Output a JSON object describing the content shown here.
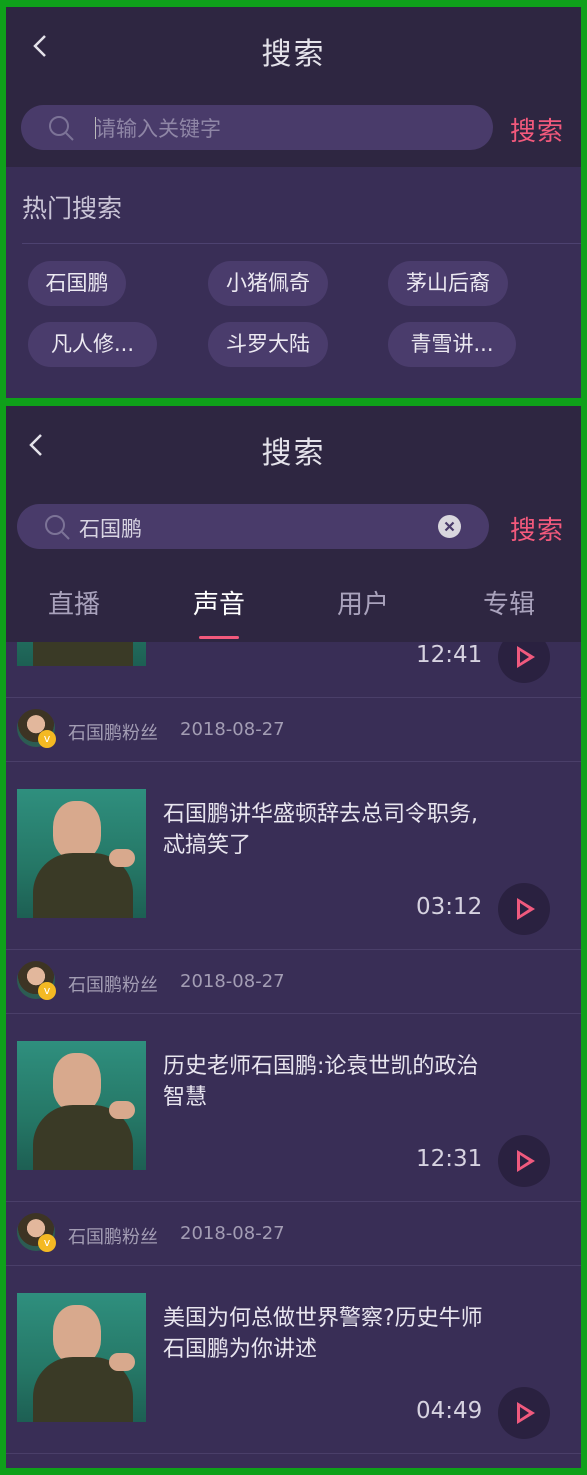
{
  "screen1": {
    "header_title": "搜索",
    "search_placeholder": "请输入关键字",
    "search_button": "搜索",
    "hot_search_title": "热门搜索",
    "hot_tags": [
      "石国鹏",
      "小猪佩奇",
      "茅山后裔",
      "凡人修...",
      "斗罗大陆",
      "青雪讲..."
    ]
  },
  "screen2": {
    "header_title": "搜索",
    "search_value": "石国鹏",
    "search_button": "搜索",
    "tabs": [
      {
        "label": "直播",
        "active": false
      },
      {
        "label": "声音",
        "active": true
      },
      {
        "label": "用户",
        "active": false
      },
      {
        "label": "专辑",
        "active": false
      }
    ],
    "partial_item": {
      "duration": "12:41"
    },
    "items": [
      {
        "author": "石国鹏粉丝",
        "date": "2018-08-27",
        "title_line1": "石国鹏讲华盛顿辞去总司令职务,",
        "title_line2": "忒搞笑了",
        "duration": "03:12"
      },
      {
        "author": "石国鹏粉丝",
        "date": "2018-08-27",
        "title_line1": "历史老师石国鹏:论袁世凯的政治",
        "title_line2": "智慧",
        "duration": "12:31"
      },
      {
        "author": "石国鹏粉丝",
        "date": "2018-08-27",
        "title_line1": "美国为何总做世界警察?历史牛师",
        "title_line2": "石国鹏为你讲述",
        "duration": "04:49"
      }
    ]
  },
  "colors": {
    "background": "#392e56",
    "header": "#2e2641",
    "accent": "#f2597c",
    "frame": "#0fa01a"
  }
}
